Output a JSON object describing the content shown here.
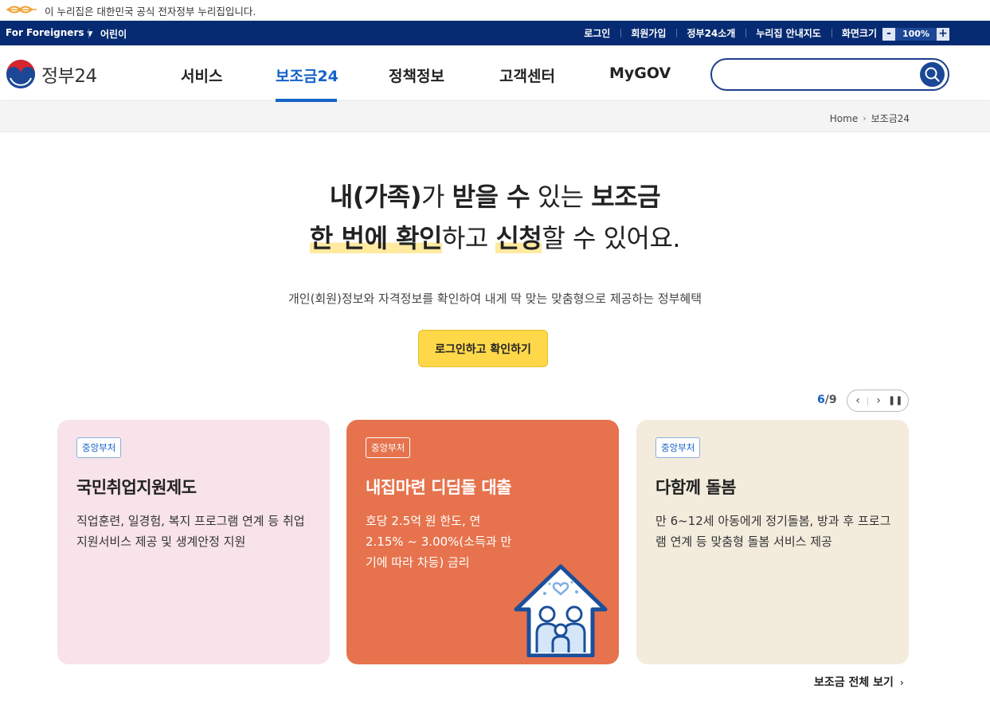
{
  "notice": {
    "text": "이 누리집은 대한민국 공식 전자정부 누리집입니다.",
    "logo_icon": "eg-logo-icon"
  },
  "util": {
    "foreigners": "For Foreigners",
    "kids": "어린이",
    "links": [
      "로그인",
      "회원가입",
      "정부24소개",
      "누리집 안내지도",
      "화면크기"
    ],
    "zoom_minus": "-",
    "zoom_value": "100%",
    "zoom_plus": "+"
  },
  "header": {
    "logo_text": "정부24",
    "menu": [
      "서비스",
      "보조금24",
      "정책정보",
      "고객센터",
      "MyGOV"
    ],
    "active_menu": "보조금24",
    "search_placeholder": "",
    "search_value": ""
  },
  "breadcrumb": {
    "home": "Home",
    "current": "보조금24"
  },
  "hero": {
    "line1": {
      "a": "내(가족)",
      "b": "가 ",
      "c": "받을 수",
      "d": " 있는 ",
      "e": "보조금"
    },
    "line2": {
      "a": "한 번에 확인",
      "b": "하고 ",
      "c": "신청",
      "d": "할 수 있어요."
    },
    "subtitle": "개인(회원)정보와 자격정보를 확인하여 내게 딱 맞는 맞춤형으로 제공하는 정부혜택",
    "cta": "로그인하고 확인하기"
  },
  "carousel": {
    "current": "6",
    "total": "9",
    "separator": "/",
    "prev_icon": "chevron-left-icon",
    "next_icon": "chevron-right-icon",
    "pause_icon": "pause-icon"
  },
  "cards": [
    {
      "badge": "중앙부처",
      "title": "국민취업지원제도",
      "desc": "직업훈련, 일경험, 복지 프로그램 연계 등 취업지원서비스 제공 및 생계안정 지원",
      "bg": "#f8e3ea"
    },
    {
      "badge": "중앙부처",
      "title": "내집마련 디딤돌 대출",
      "desc": "호당 2.5억 원 한도, 연 2.15% ~ 3.00%(소득과 만기에 따라 차등) 금리",
      "bg": "#e6734d",
      "illustration": "house-family-icon"
    },
    {
      "badge": "중앙부처",
      "title": "다함께 돌봄",
      "desc": "만 6~12세 아동에게 정기돌봄, 방과 후 프로그램 연계 등 맞춤형 돌봄 서비스 제공",
      "bg": "#f3ecdd"
    }
  ],
  "view_all": "보조금 전체 보기",
  "colors": {
    "navy": "#062b72",
    "accent_blue": "#1462c8",
    "cta_yellow": "#ffd84a",
    "highlight": "#ffeaa0"
  }
}
